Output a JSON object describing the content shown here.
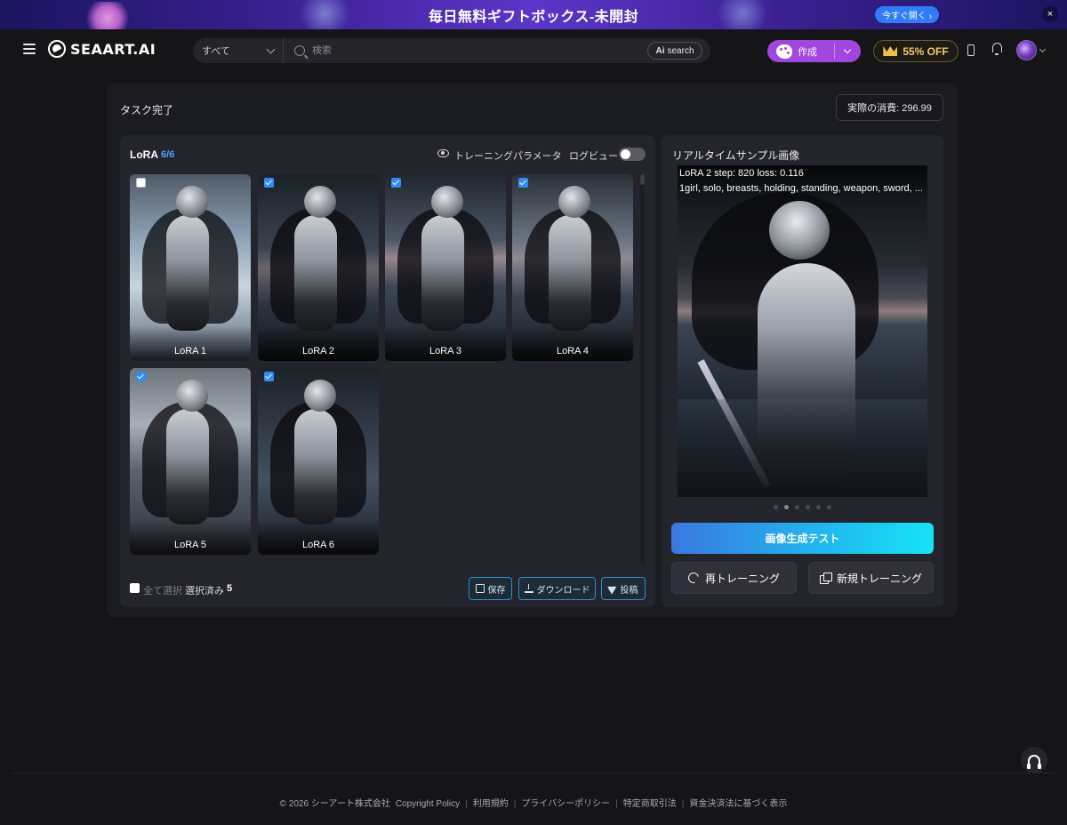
{
  "banner": {
    "title": "毎日無料ギフトボックス-未開封",
    "cta": "今すぐ開く ›",
    "close": "×"
  },
  "header": {
    "logo": "SEAART.AI",
    "search": {
      "category": "すべて",
      "placeholder": "検索",
      "ai_label_prefix": "Ai",
      "ai_label": "search"
    },
    "create_label": "作成",
    "vip_label": "55% OFF"
  },
  "task": {
    "title": "タスク完了",
    "cost": "実際の消費: 296.99"
  },
  "lora_panel": {
    "title": "LoRA",
    "count": "6/6",
    "param_label": "トレーニングパラメータ",
    "log_label": "ログビュー",
    "log_toggle_on": false,
    "thumbnails": [
      {
        "label": "LoRA 1",
        "checked": false
      },
      {
        "label": "LoRA 2",
        "checked": true
      },
      {
        "label": "LoRA 3",
        "checked": true
      },
      {
        "label": "LoRA 4",
        "checked": true
      },
      {
        "label": "LoRA 5",
        "checked": true
      },
      {
        "label": "LoRA 6",
        "checked": true
      }
    ],
    "select_all": "全て選択",
    "selected_label": "選択済み",
    "selected_count": "5",
    "save": "保存",
    "download": "ダウンロード",
    "post": "投稿"
  },
  "sample_panel": {
    "title": "リアルタイムサンプル画像",
    "step_info": "LoRA 2 step: 820 loss: 0.116",
    "tags": "1girl, solo, breasts, holding, standing, weapon, sword, ...",
    "active_dot": 1,
    "dot_count": 6,
    "generate_test": "画像生成テスト",
    "retrain": "再トレーニング",
    "new_training": "新規トレーニング"
  },
  "footer": {
    "items": [
      "© 2026 シーアート株式会社",
      "Copyright Policy",
      "利用規約",
      "プライバシーポリシー",
      "特定商取引法",
      "資金決済法に基づく表示"
    ]
  },
  "colors": {
    "accent_blue": "#2f8cf5",
    "create_purple": "#a246e0",
    "vip_gold": "#f3c96a",
    "generate_gradient_start": "#3a78e0",
    "generate_gradient_end": "#16e3f6"
  }
}
